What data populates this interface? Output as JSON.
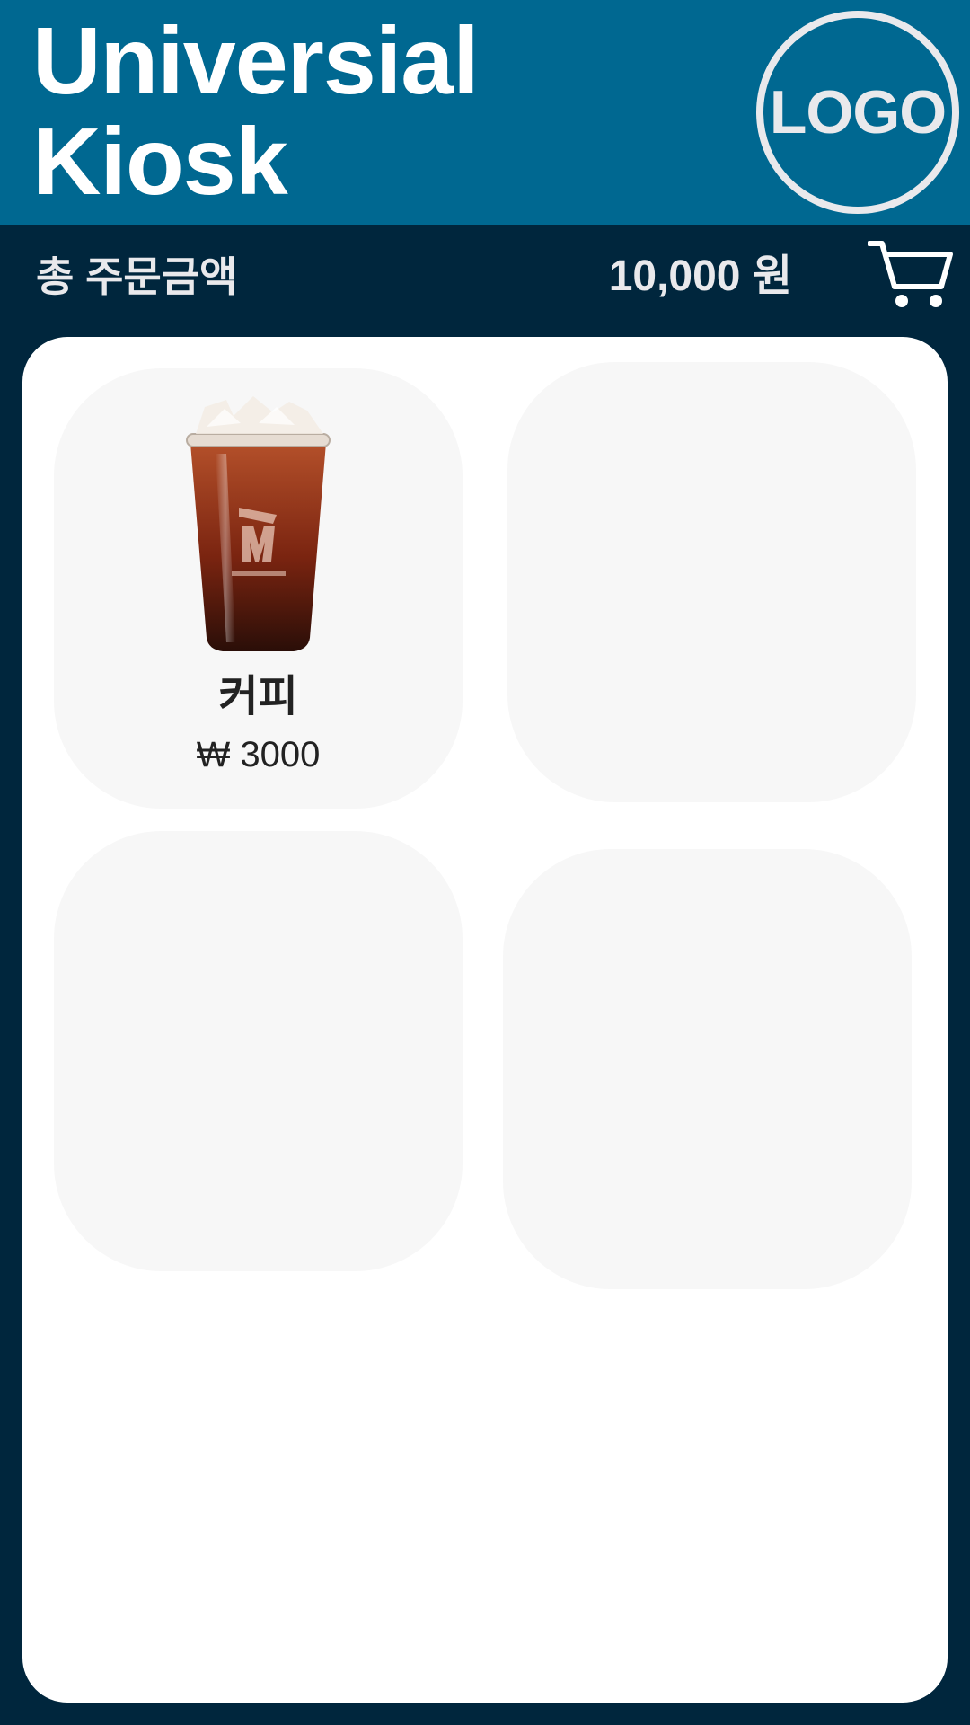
{
  "header": {
    "title": "Universial Kiosk",
    "logo_text": "LOGO"
  },
  "order_summary": {
    "label": "총 주문금액",
    "total": "10,000 원",
    "cart_icon": "shopping-cart-icon"
  },
  "menu": {
    "items": [
      {
        "name": "커피",
        "price": "₩ 3000",
        "image_icon": "iced-coffee-cup-image"
      },
      {
        "name": "",
        "price": ""
      },
      {
        "name": "",
        "price": ""
      },
      {
        "name": "",
        "price": ""
      }
    ]
  },
  "colors": {
    "header_bg": "#006891",
    "page_bg": "#00263d",
    "panel_bg": "#ffffff",
    "card_bg": "#f7f7f7",
    "light_text": "#e9e9ec",
    "dark_text": "#222222"
  }
}
